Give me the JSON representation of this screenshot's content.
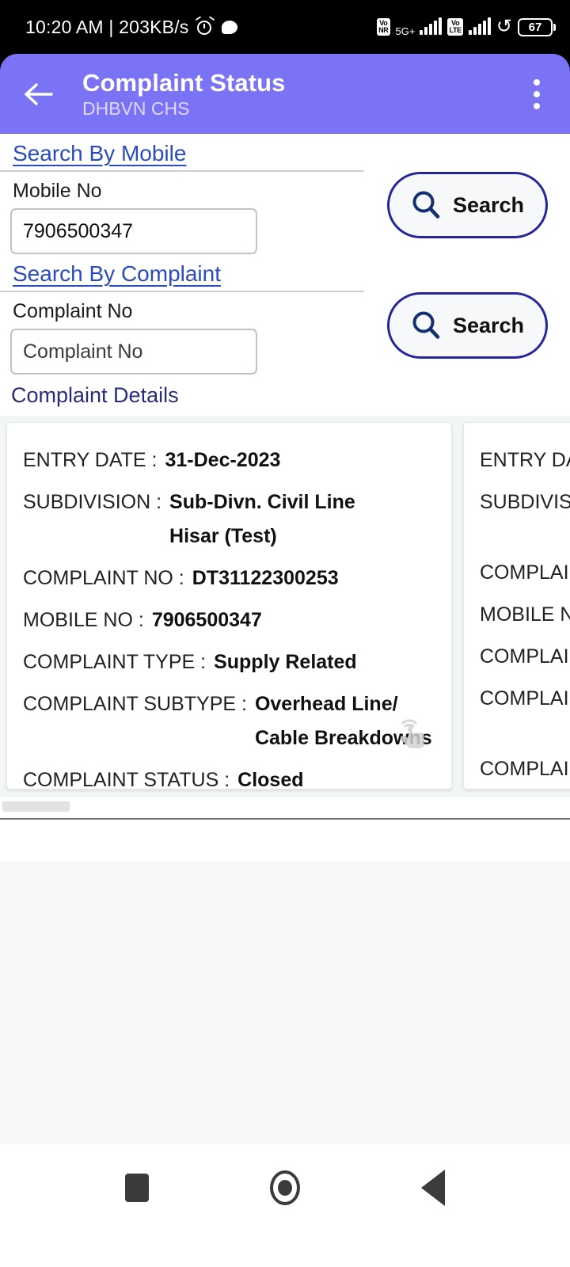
{
  "status_bar": {
    "clock": "10:20 AM | 203KB/s",
    "alarm_icon": "alarm-clock-icon",
    "chat_icon": "chat-bubble-icon",
    "sim1_badge_line1": "Vo",
    "sim1_badge_line2": "NR",
    "network_type": "5G+",
    "sim2_badge_line1": "Vo",
    "sim2_badge_line2": "LTE",
    "sync_icon": "sync-loop-icon",
    "battery_percent": "67"
  },
  "appbar": {
    "back_icon": "back-arrow-icon",
    "title": "Complaint Status",
    "subtitle": "DHBVN CHS",
    "overflow_icon": "three-dot-menu-icon",
    "background_color": "#7b73f5"
  },
  "search_by_mobile": {
    "link_label": "Search By Mobile",
    "field_label": "Mobile No",
    "input_value": "7906500347",
    "input_placeholder": "Mobile No",
    "button_label": "Search",
    "button_icon": "search-magnifier-icon"
  },
  "search_by_complaint": {
    "link_label": "Search By Complaint",
    "field_label": "Complaint No",
    "input_value": "",
    "input_placeholder": "Complaint No",
    "button_label": "Search",
    "button_icon": "search-magnifier-icon"
  },
  "complaint_details": {
    "heading": "Complaint Details",
    "labels": {
      "entry_date": "ENTRY DATE :",
      "subdivision": "SUBDIVISION :",
      "complaint_no": "COMPLAINT NO :",
      "mobile_no": "MOBILE NO :",
      "complaint_type": "COMPLAINT TYPE :",
      "complaint_subtype": "COMPLAINT SUBTYPE :",
      "complaint_status": "COMPLAINT STATUS :"
    },
    "cards": [
      {
        "entry_date": "31-Dec-2023",
        "subdivision": "Sub-Divn. Civil Line Hisar (Test)",
        "complaint_no": "DT31122300253",
        "mobile_no": "7906500347",
        "complaint_type": "Supply Related",
        "complaint_subtype": "Overhead Line/ Cable Breakdowns",
        "complaint_status": "Closed",
        "touch_hint_icon": "tap-gesture-icon"
      }
    ],
    "scrollbar": "horizontal-scrollbar"
  },
  "navbar": {
    "recents_icon": "recents-square-icon",
    "home_icon": "home-circle-icon",
    "back_icon": "back-triangle-icon"
  },
  "colors": {
    "accent_purple": "#7b73f5",
    "link_blue": "#2a4bbf",
    "heading_navy": "#2b2b7a",
    "button_border": "#26269c"
  }
}
